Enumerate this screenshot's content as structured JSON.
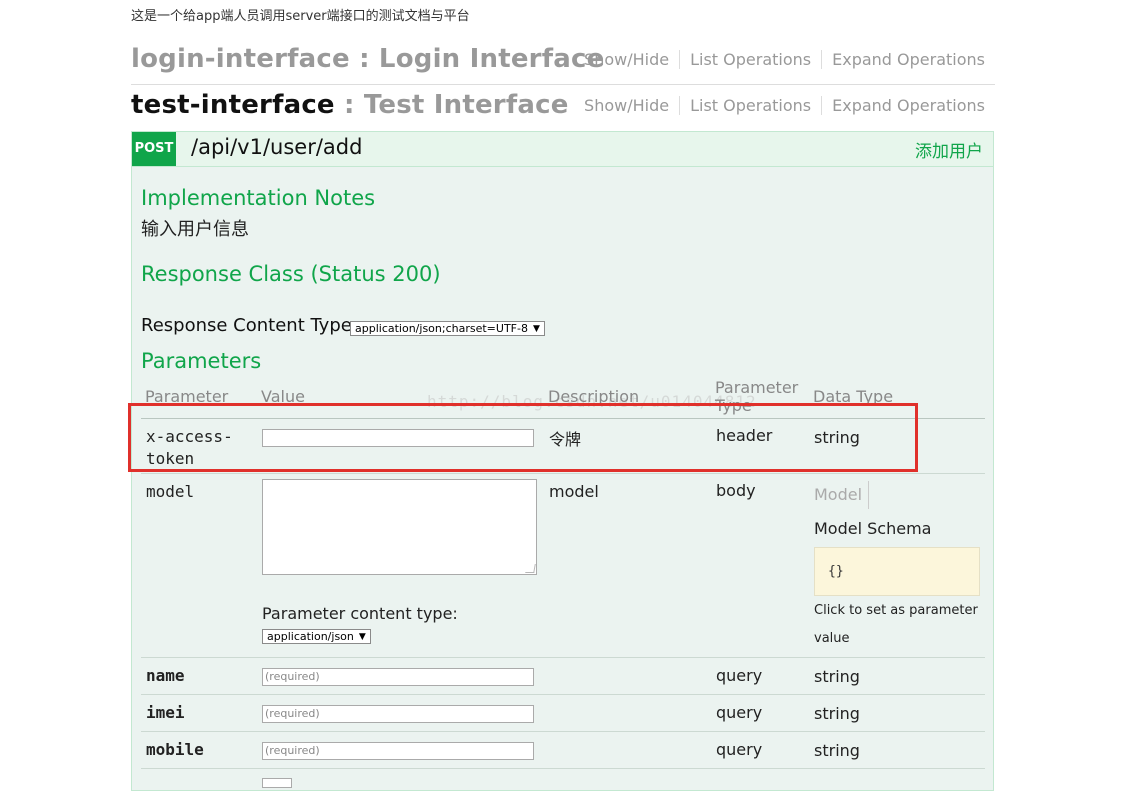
{
  "page": {
    "subtitle": "这是一个给app端人员调用server端接口的测试文档与平台"
  },
  "resources": [
    {
      "name": "login-interface",
      "separator": " : ",
      "description": "Login Interface",
      "ops": [
        "Show/Hide",
        "List Operations",
        "Expand Operations"
      ]
    },
    {
      "name": "test-interface",
      "separator": " : ",
      "description": "Test Interface",
      "ops": [
        "Show/Hide",
        "List Operations",
        "Expand Operations"
      ]
    }
  ],
  "endpoint": {
    "method": "POST",
    "path": "/api/v1/user/add",
    "summary": "添加用户",
    "implementation_notes_title": "Implementation Notes",
    "implementation_notes": "输入用户信息",
    "response_class_title": "Response Class (Status 200)",
    "response_content_type_label": "Response Content Type",
    "response_content_type": "application/json;charset=UTF-8",
    "parameters_title": "Parameters"
  },
  "params_table": {
    "headers": {
      "parameter": "Parameter",
      "value": "Value",
      "description": "Description",
      "param_type_1": "Parameter",
      "param_type_2": "Type",
      "data_type": "Data Type"
    },
    "rows": [
      {
        "name_1": "x-access-",
        "name_2": "token",
        "value": "",
        "description": "令牌",
        "param_type": "header",
        "data_type": "string"
      },
      {
        "name": "model",
        "description": "model",
        "param_type": "body",
        "model_tab": "Model",
        "model_schema_tab": "Model Schema",
        "schema": "{}",
        "click_note_1": "Click to set as parameter",
        "click_note_2": "value",
        "content_type_label": "Parameter content type:",
        "content_type": "application/json"
      },
      {
        "name": "name",
        "placeholder": "(required)",
        "param_type": "query",
        "data_type": "string"
      },
      {
        "name": "imei",
        "placeholder": "(required)",
        "param_type": "query",
        "data_type": "string"
      },
      {
        "name": "mobile",
        "placeholder": "(required)",
        "param_type": "query",
        "data_type": "string"
      }
    ]
  },
  "watermark": "http://blog.csdn.net/u014044812",
  "colors": {
    "accent_green": "#10a54a",
    "endpoint_bg": "#ebf3f0",
    "highlight_red": "#e0302b",
    "schema_bg": "#fcf6db"
  }
}
